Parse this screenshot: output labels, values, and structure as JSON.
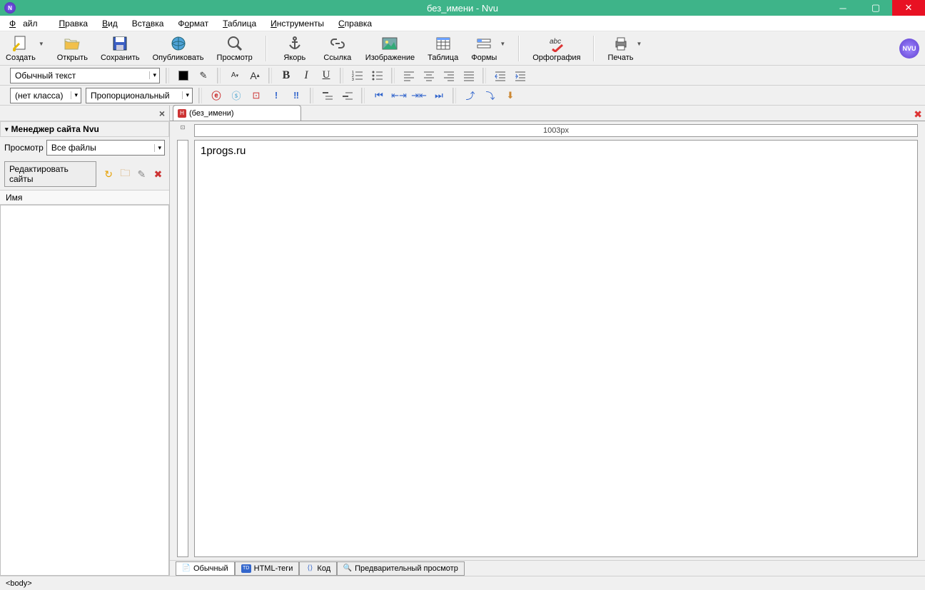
{
  "window": {
    "title": "без_имени - Nvu",
    "app_icon_text": "N"
  },
  "menus": [
    "Файл",
    "Правка",
    "Вид",
    "Вставка",
    "Формат",
    "Таблица",
    "Инструменты",
    "Справка"
  ],
  "toolbar": {
    "create": "Создать",
    "open": "Открыть",
    "save": "Сохранить",
    "publish": "Опубликовать",
    "preview": "Просмотр",
    "anchor": "Якорь",
    "link": "Ссылка",
    "image": "Изображение",
    "table": "Таблица",
    "forms": "Формы",
    "spell": "Орфография",
    "print": "Печать",
    "logo": "NVU"
  },
  "format": {
    "paragraph": "Обычный текст",
    "class": "(нет класса)",
    "font": "Пропорциональный"
  },
  "sidebar": {
    "title": "Менеджер сайта Nvu",
    "view_label": "Просмотр",
    "view_value": "Все файлы",
    "edit_sites": "Редактировать сайты",
    "col_name": "Имя"
  },
  "doc": {
    "tab": "(без_имени)",
    "ruler": "1003px",
    "content": "1progs.ru"
  },
  "viewtabs": {
    "normal": "Обычный",
    "tags": "HTML-теги",
    "source": "Код",
    "preview": "Предварительный просмотр"
  },
  "status": "<body>"
}
